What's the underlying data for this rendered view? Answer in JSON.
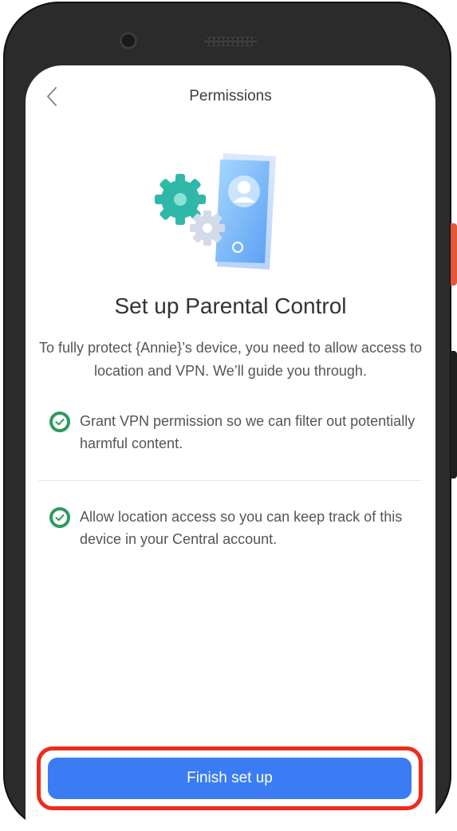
{
  "header": {
    "title": "Permissions",
    "back_icon": "chevron-left-icon"
  },
  "illustration": {
    "name": "phone-with-gears-illustration"
  },
  "main": {
    "heading": "Set up Parental Control",
    "description": "To fully protect {Annie}’s device, you need to allow access to location and VPN. We’ll guide you through.",
    "items": [
      {
        "icon": "check-circle-icon",
        "text": "Grant VPN permission so we can filter out potentially harmful content."
      },
      {
        "icon": "check-circle-icon",
        "text": "Allow location access so you can keep track of this device in your Central account."
      }
    ]
  },
  "footer": {
    "button_label": "Finish set up"
  },
  "colors": {
    "accent": "#3b7cf4",
    "check_green": "#2e9a5c",
    "highlight_outline": "#ee2b1c",
    "device_frame": "#2b2b2b",
    "side_button": "#e4573b"
  }
}
